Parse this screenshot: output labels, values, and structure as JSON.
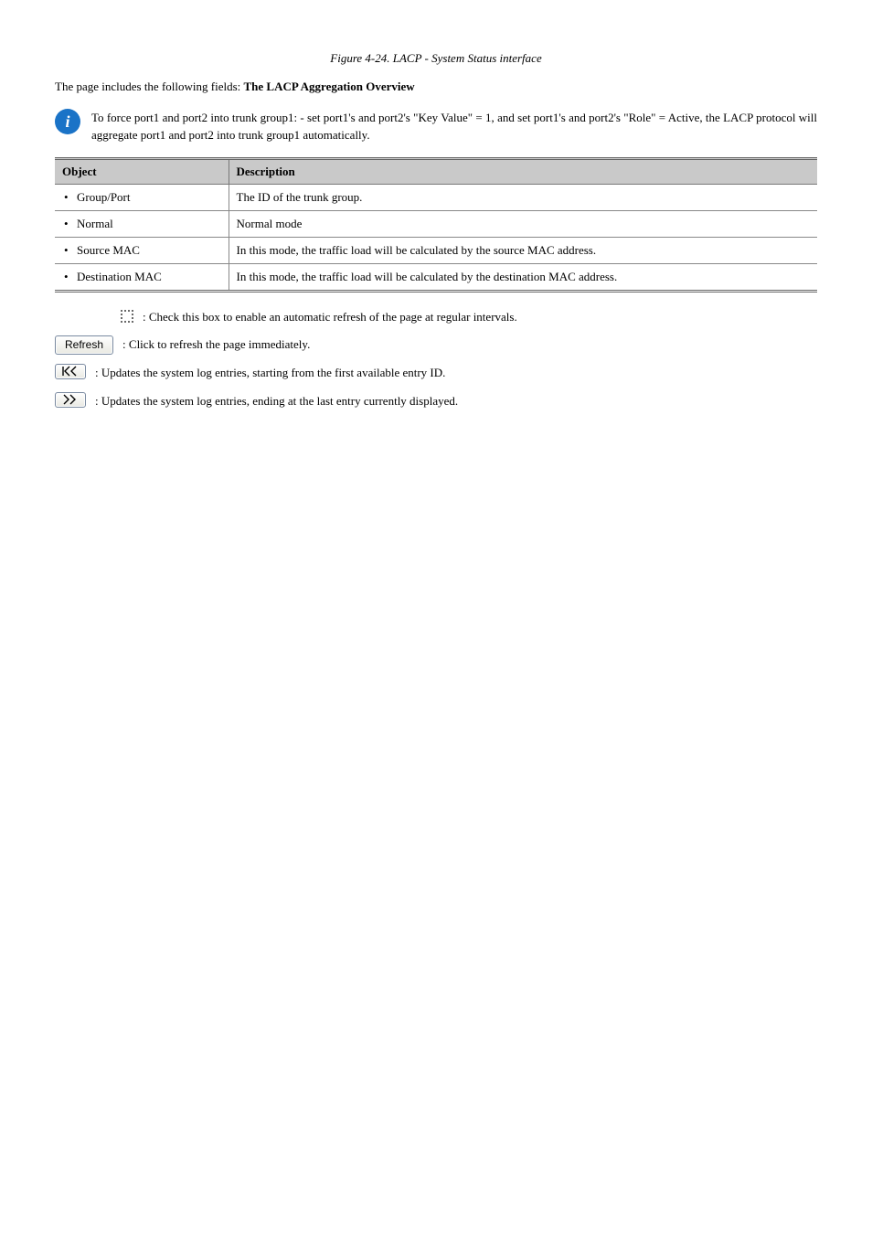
{
  "figure_label": "Figure 4-24. LACP - System Status interface",
  "intro_paragraph_prefix": "The page includes the following fields: ",
  "intro_paragraph_bold": "The LACP Aggregation Overview",
  "note_text": "To force port1 and port2 into trunk group1: - set port1's and port2's \"Key Value\" = 1, and set port1's and port2's \"Role\" = Active, the LACP protocol will aggregate port1 and port2 into trunk group1 automatically.",
  "table": {
    "head_object": "Object",
    "head_description": "Description",
    "rows": [
      {
        "object": "Group/Port",
        "description": "The ID of the trunk group."
      },
      {
        "object": "Normal",
        "description": "Normal mode"
      },
      {
        "object": "Source MAC",
        "description": "In this mode, the traffic load will be calculated by the source MAC address."
      },
      {
        "object": "Destination MAC",
        "description": "In this mode, the traffic load will be calculated by the destination MAC address."
      }
    ]
  },
  "controls": {
    "autorefresh": ": Check this box to enable an automatic refresh of the page at regular intervals.",
    "refresh_label": "Refresh",
    "refresh_desc": ": Click to refresh the page immediately.",
    "first_label": "|<<",
    "first_desc": ": Updates the system log entries, starting from the first available entry ID.",
    "next_label": ">>",
    "next_desc": ": Updates the system log entries, ending at the last entry currently displayed."
  }
}
